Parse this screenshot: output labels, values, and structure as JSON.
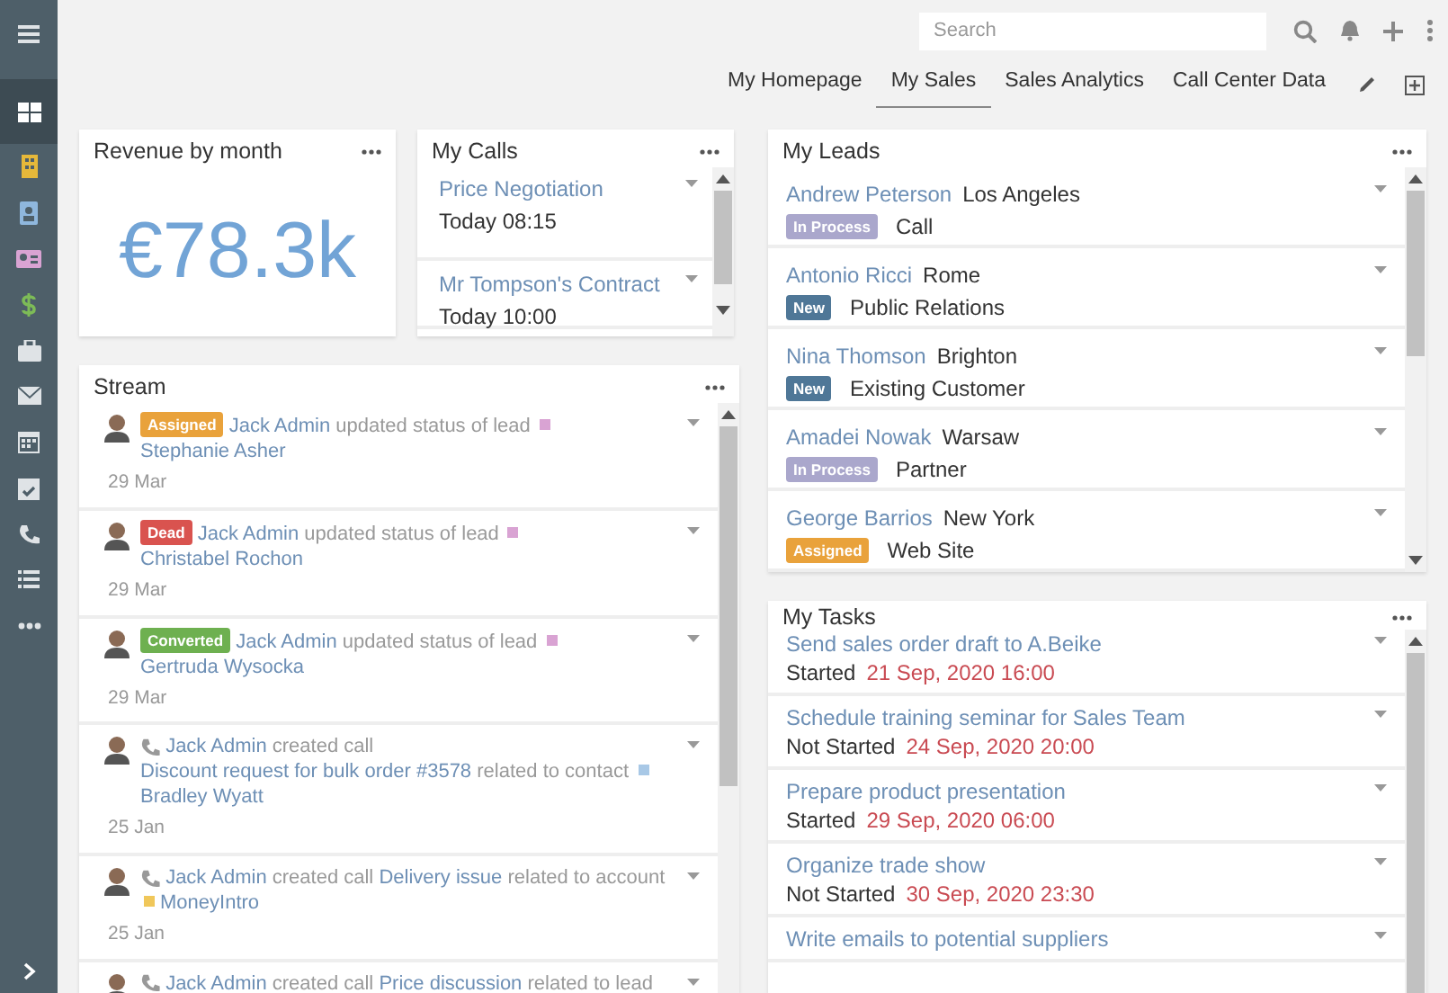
{
  "sidebar": {
    "items": [
      {
        "kind": "dashboard",
        "selected": true
      },
      {
        "kind": "building",
        "selected": false
      },
      {
        "kind": "contact",
        "selected": false
      },
      {
        "kind": "idcard",
        "selected": false
      },
      {
        "kind": "dollar",
        "selected": false
      },
      {
        "kind": "briefcase",
        "selected": false
      },
      {
        "kind": "envelope",
        "selected": false
      },
      {
        "kind": "calendar",
        "selected": false
      },
      {
        "kind": "calendarcheck",
        "selected": false
      },
      {
        "kind": "phone",
        "selected": false
      },
      {
        "kind": "list",
        "selected": false
      },
      {
        "kind": "more",
        "selected": false
      }
    ]
  },
  "search": {
    "placeholder": "Search"
  },
  "tabs": [
    {
      "label": "My Homepage",
      "selected": false
    },
    {
      "label": "My Sales",
      "selected": true
    },
    {
      "label": "Sales Analytics",
      "selected": false
    },
    {
      "label": "Call Center Data",
      "selected": false
    }
  ],
  "revenue": {
    "title": "Revenue by month",
    "value": "€78.3k"
  },
  "calls": {
    "title": "My Calls",
    "items": [
      {
        "name": "Price Negotiation",
        "time": "Today 08:15"
      },
      {
        "name": "Mr Tompson's Contract",
        "time": "Today 10:00"
      }
    ]
  },
  "stream": {
    "title": "Stream",
    "items": [
      {
        "kind": "status",
        "badge": {
          "text": "Assigned",
          "color": "#e9a23b"
        },
        "user": "Jack Admin",
        "action": "updated status of lead",
        "target": {
          "text": "Stephanie Asher",
          "color": "#d9a3d3"
        },
        "date": "29 Mar"
      },
      {
        "kind": "status",
        "badge": {
          "text": "Dead",
          "color": "#d9534f"
        },
        "user": "Jack Admin",
        "action": "updated status of lead",
        "target": {
          "text": "Christabel Rochon",
          "color": "#d9a3d3"
        },
        "date": "29 Mar"
      },
      {
        "kind": "status",
        "badge": {
          "text": "Converted",
          "color": "#6eb050"
        },
        "user": "Jack Admin",
        "action": "updated status of lead",
        "target": {
          "text": "Gertruda Wysocka",
          "color": "#d9a3d3"
        },
        "date": "29 Mar"
      },
      {
        "kind": "call",
        "user": "Jack Admin",
        "action": "created call",
        "subject": "Discount request for bulk order #3578",
        "relation": "related to contact",
        "target": {
          "text": "Bradley Wyatt",
          "color": "#a8c8e6"
        },
        "date": "25 Jan"
      },
      {
        "kind": "call",
        "user": "Jack Admin",
        "action": "created call",
        "subject": "Delivery issue",
        "relation": "related to account",
        "target": {
          "text": "MoneyIntro",
          "color": "#f0c75a"
        },
        "date": "25 Jan"
      },
      {
        "kind": "call",
        "user": "Jack Admin",
        "action": "created call",
        "subject": "Price discussion",
        "relation": "related to lead"
      }
    ]
  },
  "leads": {
    "title": "My Leads",
    "items": [
      {
        "name": "Andrew Peterson",
        "city": "Los Angeles",
        "status": {
          "text": "In Process",
          "color": "#aaa7cc"
        },
        "source": "Call"
      },
      {
        "name": "Antonio Ricci",
        "city": "Rome",
        "status": {
          "text": "New",
          "color": "#4f7797"
        },
        "source": "Public Relations"
      },
      {
        "name": "Nina Thomson",
        "city": "Brighton",
        "status": {
          "text": "New",
          "color": "#4f7797"
        },
        "source": "Existing Customer"
      },
      {
        "name": "Amadei Nowak",
        "city": "Warsaw",
        "status": {
          "text": "In Process",
          "color": "#aaa7cc"
        },
        "source": "Partner"
      },
      {
        "name": "George Barrios",
        "city": "New York",
        "status": {
          "text": "Assigned",
          "color": "#e9a23b"
        },
        "source": "Web Site"
      }
    ]
  },
  "tasks": {
    "title": "My Tasks",
    "items": [
      {
        "title": "Send sales order draft to A.Beike",
        "status": "Started",
        "date": "21 Sep, 2020 16:00"
      },
      {
        "title": "Schedule training seminar for Sales Team",
        "status": "Not Started",
        "date": "24 Sep, 2020 20:00"
      },
      {
        "title": "Prepare product presentation",
        "status": "Started",
        "date": "29 Sep, 2020 06:00"
      },
      {
        "title": "Organize trade show",
        "status": "Not Started",
        "date": "30 Sep, 2020 23:30"
      },
      {
        "title": "Write emails to potential suppliers"
      }
    ]
  }
}
